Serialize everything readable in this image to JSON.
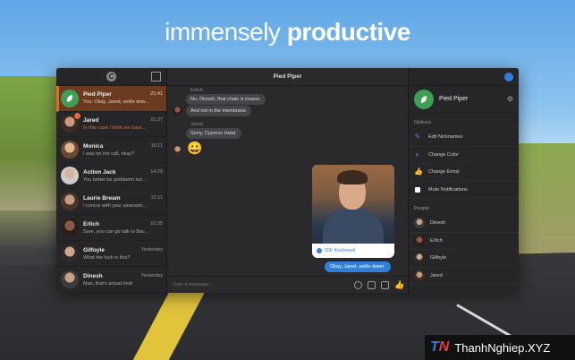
{
  "headline": {
    "light": "immensely ",
    "bold": "productive"
  },
  "watermark": {
    "logo_a": "T",
    "logo_b": "N",
    "text": "ThanhNghiep.XYZ"
  },
  "sidebar": {
    "conversations": [
      {
        "name": "Pied Piper",
        "time": "21:41",
        "preview": "You: Okay, Jared, settle dow...",
        "active": true
      },
      {
        "name": "Jared",
        "time": "21:37",
        "preview": "In this case I think we have...",
        "unread": true
      },
      {
        "name": "Monica",
        "time": "16:11",
        "preview": "I was on the call, okay?"
      },
      {
        "name": "Action Jack",
        "time": "14:29",
        "preview": "You better be goddamn sur..."
      },
      {
        "name": "Laurie Bream",
        "time": "12:11",
        "preview": "I concur with your assessm..."
      },
      {
        "name": "Erlich",
        "time": "10:35",
        "preview": "Sure, you can go talk to Bac..."
      },
      {
        "name": "Gilfoyle",
        "time": "Yesterday",
        "preview": "What the fuck is this?"
      },
      {
        "name": "Dinesh",
        "time": "Yesterday",
        "preview": "Man, that's actual rindi"
      }
    ]
  },
  "chat": {
    "title": "Pied Piper",
    "messages": [
      {
        "sender": "Erlich",
        "lines": [
          "No, Dinesh, that chain is insane.",
          "And not in the membrane."
        ]
      },
      {
        "sender": "Jared",
        "lines": [
          "Sorry, Cypress Halal."
        ],
        "emoji": "😀"
      }
    ],
    "gif_label": "GIF Keyboard",
    "outgoing": "Okay, Jared, settle down.",
    "composer_placeholder": "Type a message..."
  },
  "info": {
    "name": "Pied Piper",
    "options_title": "Options",
    "options": [
      "Edit Nicknames",
      "Change Color",
      "Change Emoji",
      "Mute Notifications"
    ],
    "people_title": "People",
    "people": [
      "Dinesh",
      "Erlich",
      "Gilfoyle",
      "Jared"
    ]
  },
  "colors": {
    "accent": "#e8682a",
    "messenger_blue": "#2f7fdc"
  }
}
